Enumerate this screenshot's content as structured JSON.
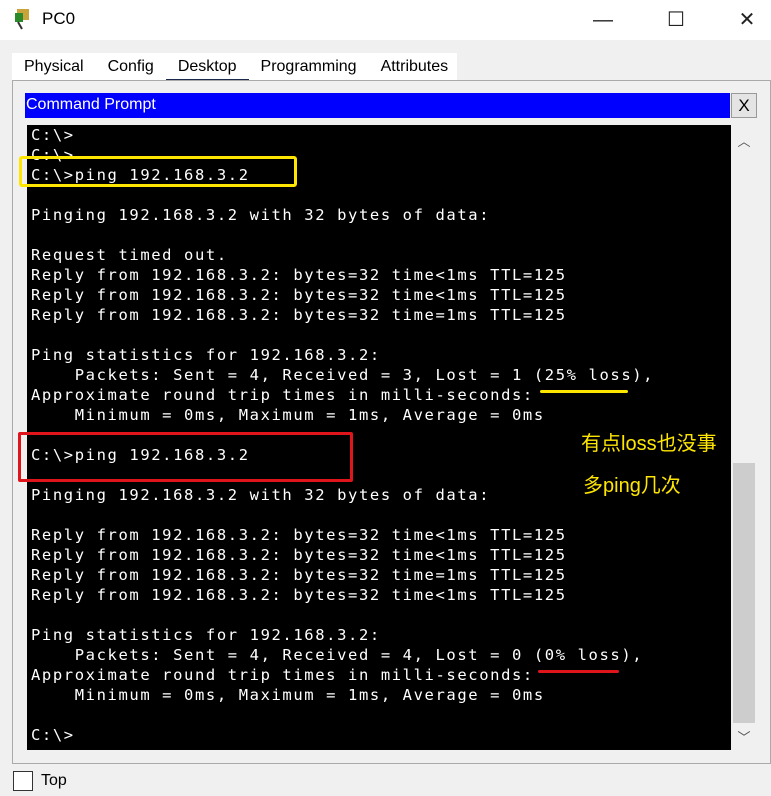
{
  "window": {
    "title": "PC0",
    "minimize": "—",
    "maximize": "☐",
    "close": "✕"
  },
  "tabs": [
    "Physical",
    "Config",
    "Desktop",
    "Programming",
    "Attributes"
  ],
  "active_tab": "Desktop",
  "cmd": {
    "title": "Command Prompt",
    "close": "X"
  },
  "terminal_lines": [
    "C:\\>",
    "C:\\>",
    "C:\\>ping 192.168.3.2",
    "",
    "Pinging 192.168.3.2 with 32 bytes of data:",
    "",
    "Request timed out.",
    "Reply from 192.168.3.2: bytes=32 time<1ms TTL=125",
    "Reply from 192.168.3.2: bytes=32 time<1ms TTL=125",
    "Reply from 192.168.3.2: bytes=32 time=1ms TTL=125",
    "",
    "Ping statistics for 192.168.3.2:",
    "    Packets: Sent = 4, Received = 3, Lost = 1 (25% loss),",
    "Approximate round trip times in milli-seconds:",
    "    Minimum = 0ms, Maximum = 1ms, Average = 0ms",
    "",
    "C:\\>ping 192.168.3.2",
    "",
    "Pinging 192.168.3.2 with 32 bytes of data:",
    "",
    "Reply from 192.168.3.2: bytes=32 time<1ms TTL=125",
    "Reply from 192.168.3.2: bytes=32 time<1ms TTL=125",
    "Reply from 192.168.3.2: bytes=32 time=1ms TTL=125",
    "Reply from 192.168.3.2: bytes=32 time<1ms TTL=125",
    "",
    "Ping statistics for 192.168.3.2:",
    "    Packets: Sent = 4, Received = 4, Lost = 0 (0% loss),",
    "Approximate round trip times in milli-seconds:",
    "    Minimum = 0ms, Maximum = 1ms, Average = 0ms",
    "",
    "C:\\>"
  ],
  "annotations": {
    "note1": "有点loss也没事",
    "note2": "多ping几次",
    "yellow": "#ffe600",
    "red": "#e0151b"
  },
  "scroll": {
    "up": "︿",
    "down": "﹀"
  },
  "footer": {
    "top_label": "Top",
    "top_checked": false
  }
}
